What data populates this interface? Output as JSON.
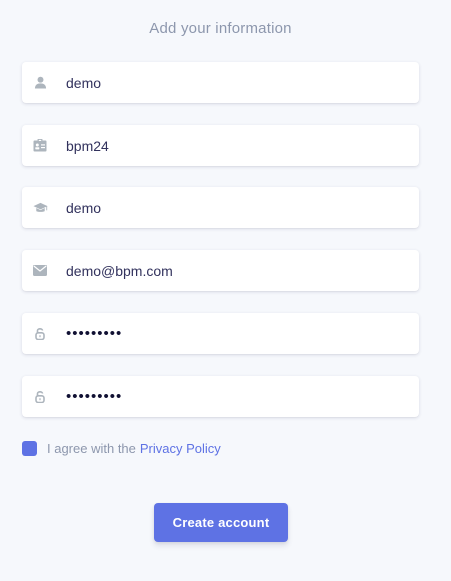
{
  "form": {
    "title": "Add your information",
    "fields": [
      {
        "icon": "user-icon",
        "type": "text",
        "value": "demo"
      },
      {
        "icon": "id-card-icon",
        "type": "text",
        "value": "bpm24"
      },
      {
        "icon": "graduation-cap-icon",
        "type": "text",
        "value": "demo"
      },
      {
        "icon": "envelope-icon",
        "type": "text",
        "value": "demo@bpm.com"
      },
      {
        "icon": "lock-icon",
        "type": "password",
        "value": "•••••••••"
      },
      {
        "icon": "lock-icon",
        "type": "password",
        "value": "•••••••••"
      }
    ],
    "agree": {
      "checked": true,
      "text": "I agree with the",
      "link_text": "Privacy Policy"
    },
    "submit_label": "Create account"
  },
  "colors": {
    "accent": "#5e72e4",
    "background": "#f6f8fc",
    "muted_text": "#8d97ad",
    "input_text": "#32325d",
    "icon": "#adb5bd"
  }
}
